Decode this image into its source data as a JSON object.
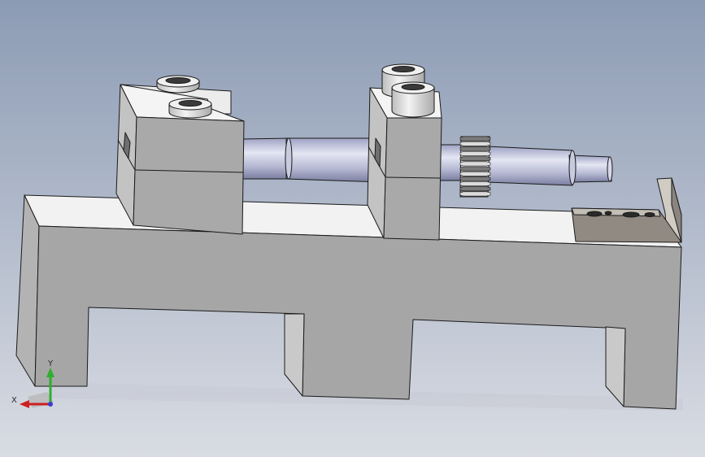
{
  "view": {
    "background_top": "#8c9bb4",
    "background_bottom": "#d9dce3"
  },
  "model": {
    "parts": [
      {
        "name": "base-plate",
        "color": "#a6a6a6"
      },
      {
        "name": "left-support-block",
        "color": "#a6a6a6"
      },
      {
        "name": "right-support-block",
        "color": "#a6a6a6"
      },
      {
        "name": "shaft",
        "color": "#c3c6dd"
      },
      {
        "name": "spur-gear",
        "color": "#d8d8d8"
      },
      {
        "name": "end-bracket",
        "color": "#8a857e"
      },
      {
        "name": "bushing",
        "color": "#d9d9d9"
      }
    ]
  },
  "triad": {
    "x_label": "X",
    "y_label": "Y",
    "x_color": "#cc1f1f",
    "y_color": "#2fae2f"
  }
}
